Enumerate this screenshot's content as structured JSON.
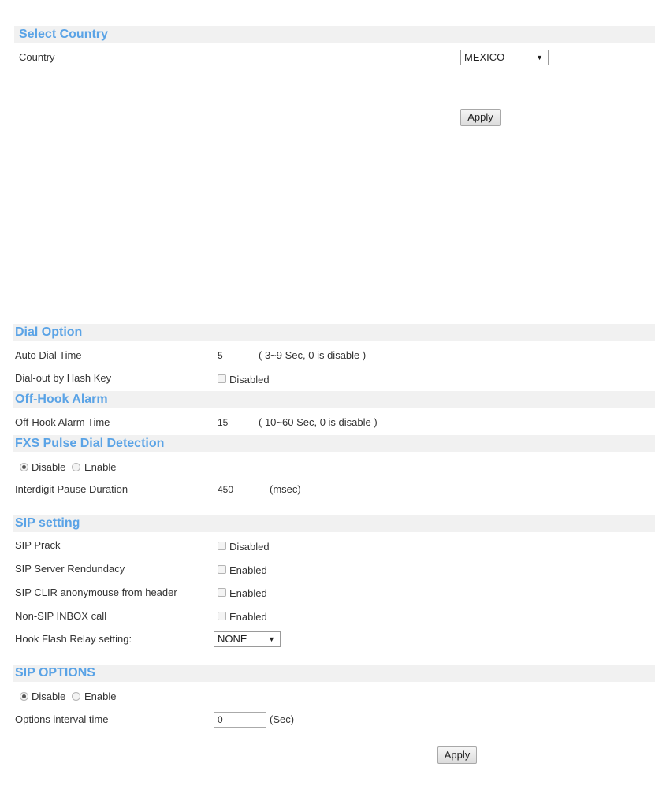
{
  "country_section": {
    "title": "Select Country",
    "country_label": "Country",
    "country_value": "MEXICO",
    "apply_label": "Apply"
  },
  "dial_option": {
    "title": "Dial Option",
    "auto_dial_label": "Auto Dial Time",
    "auto_dial_value": "5",
    "auto_dial_hint": "( 3~9 Sec, 0 is disable )",
    "hash_key_label": "Dial-out by Hash Key",
    "hash_key_checkbox_label": "Disabled",
    "hash_key_checked": false
  },
  "off_hook": {
    "title": "Off-Hook Alarm",
    "alarm_time_label": "Off-Hook Alarm Time",
    "alarm_time_value": "15",
    "alarm_time_hint": "( 10~60 Sec, 0 is disable )"
  },
  "fxs_pulse": {
    "title": "FXS Pulse Dial Detection",
    "disable_label": "Disable",
    "enable_label": "Enable",
    "selected": "Disable",
    "interdigit_label": "Interdigit Pause Duration",
    "interdigit_value": "450",
    "interdigit_unit": "(msec)"
  },
  "sip_setting": {
    "title": "SIP setting",
    "prack_label": "SIP Prack",
    "prack_checkbox_label": "Disabled",
    "redundancy_label": "SIP Server Rendundacy",
    "redundancy_checkbox_label": "Enabled",
    "clir_label": "SIP CLIR anonymouse from header",
    "clir_checkbox_label": "Enabled",
    "inbox_label": "Non-SIP INBOX call",
    "inbox_checkbox_label": "Enabled",
    "hook_flash_label": "Hook Flash Relay setting:",
    "hook_flash_value": "NONE"
  },
  "sip_options": {
    "title": "SIP OPTIONS",
    "disable_label": "Disable",
    "enable_label": "Enable",
    "selected": "Disable",
    "interval_label": "Options interval time",
    "interval_value": "0",
    "interval_unit": "(Sec)",
    "apply_label": "Apply"
  }
}
